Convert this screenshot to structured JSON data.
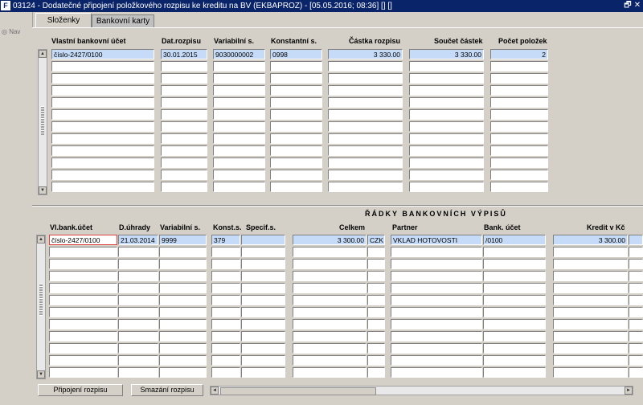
{
  "window": {
    "title": "03124 - Dodatečné připojení položkového rozpisu ke kreditu na BV (EKBAPROZ) - [05.05.2016; 08:36]  [] []",
    "logo_text": "F",
    "restore_glyph": "🗗",
    "close_glyph": "✕"
  },
  "nav": {
    "label": "Nav"
  },
  "tabs": [
    {
      "label": "Složenky"
    },
    {
      "label": "Bankovní karty"
    }
  ],
  "top_table": {
    "headers": [
      "Vlastní bankovní účet",
      "Dat.rozpisu",
      "Variabilní s.",
      "Konstantní s.",
      "Částka rozpisu",
      "Součet částek",
      "Počet položek"
    ],
    "first_row": [
      "číslo-2427/0100",
      "30.01.2015",
      "9030000002",
      "0998",
      "3 330.00",
      "3 330.00",
      "2"
    ]
  },
  "bottom_section": {
    "title": "ŘÁDKY BANKOVNÍCH VÝPISŮ",
    "headers": [
      "Vl.bank.účet",
      "D.úhrady",
      "Variabilní s.",
      "Konst.s.",
      "Specif.s.",
      "Celkem",
      "Partner",
      "Bank. účet",
      "Kredit v Kč"
    ],
    "first_row": [
      "číslo-2427/0100",
      "21.03.2014",
      "9999",
      "379",
      "",
      "3 300.00",
      "CZK",
      "VKLAD HOTOVOSTI",
      "/0100",
      "3 300.00"
    ]
  },
  "buttons": {
    "attach": "Připojení rozpisu",
    "delete": "Smazání rozpisu"
  },
  "icons": {
    "scroll_up": "▲",
    "scroll_down": "▼",
    "scroll_left": "◄",
    "scroll_right": "►"
  }
}
